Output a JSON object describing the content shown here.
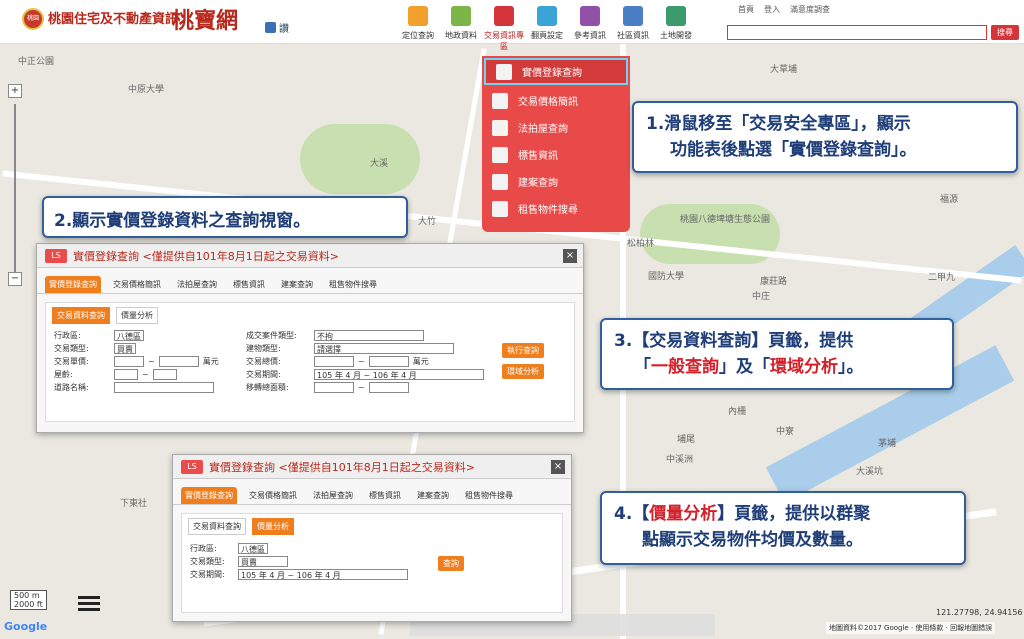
{
  "header": {
    "logo_badge_text": "桃園",
    "logo_text": "桃園住宅及不動產資訊",
    "logo_big": "桃寶網",
    "like_label": "讚",
    "nav": [
      {
        "label": "定位查詢",
        "color": "#f2a02d"
      },
      {
        "label": "地政資料",
        "color": "#7cb648"
      },
      {
        "label": "交易資訊專區",
        "color": "#d3353a"
      },
      {
        "label": "翻頁設定",
        "color": "#3aa4d6"
      },
      {
        "label": "參考資訊",
        "color": "#9251a6"
      },
      {
        "label": "社區資訊",
        "color": "#4b7ec4"
      },
      {
        "label": "土地開發",
        "color": "#3c9b6b"
      }
    ],
    "toplinks": [
      "首頁",
      "登入",
      "滿意度調查"
    ],
    "search_label": "搜尋"
  },
  "dropdown": [
    "實價登錄查詢",
    "交易價格簡訊",
    "法拍屋查詢",
    "標售資訊",
    "建案查詢",
    "租售物件搜尋"
  ],
  "callouts": {
    "c1": [
      "1.滑鼠移至「交易安全專區」，顯示",
      "功能表後點選「實價登錄查詢」。"
    ],
    "c2": "2.顯示實價登錄資料之查詢視窗。",
    "c3a": "3.【交易資料查詢】頁籤，提供",
    "c3b_pre": "「",
    "c3b_red1": "一般查詢",
    "c3b_mid": "」及「",
    "c3b_red2": "環域分析",
    "c3b_post": "」。",
    "c4a_pre": "4.【",
    "c4a_red": "價量分析",
    "c4a_post": "】頁籤，提供以群聚",
    "c4b": "點顯示交易物件均價及數量。"
  },
  "panel1": {
    "icon": "LS",
    "title": "實價登錄查詢 <僅提供自101年8月1日起之交易資料>",
    "close": "×",
    "tabs": [
      "實價登錄查詢",
      "交易價格簡訊",
      "法拍屋查詢",
      "標售資訊",
      "建案查詢",
      "租售物件搜尋"
    ],
    "subtabs": [
      "交易資料查詢",
      "價量分析"
    ],
    "left": [
      {
        "label": "行政區:",
        "value": "八德區"
      },
      {
        "label": "交易類型:",
        "value": "買賣"
      },
      {
        "label": "交易單價:",
        "value": "萬元"
      },
      {
        "label": "屋齡:",
        "value": ""
      },
      {
        "label": "道路名稱:",
        "value": ""
      }
    ],
    "right": [
      {
        "label": "成交案件類型:",
        "value": "不拘"
      },
      {
        "label": "建物類型:",
        "value": "請選擇"
      },
      {
        "label": "交易總價:",
        "value": "萬元"
      },
      {
        "label": "交易期間:",
        "value": "105 年 4 月 ~ 106 年 4 月"
      },
      {
        "label": "移轉總面積:",
        "value": ""
      }
    ],
    "btn_query": "執行查詢",
    "btn_buffer": "環域分析"
  },
  "panel2": {
    "icon": "LS",
    "title": "實價登錄查詢 <僅提供自101年8月1日起之交易資料>",
    "close": "×",
    "tabs": [
      "實價登錄查詢",
      "交易價格簡訊",
      "法拍屋查詢",
      "標售資訊",
      "建案查詢",
      "租售物件搜尋"
    ],
    "subtabs": [
      "交易資料查詢",
      "價量分析"
    ],
    "rows": [
      {
        "label": "行政區:",
        "value": "八德區"
      },
      {
        "label": "交易類型:",
        "value": "買賣"
      },
      {
        "label": "交易期間:",
        "value": "105 年 4 月 ~ 106 年 4 月"
      }
    ],
    "btn_query": "查詢"
  },
  "map_labels": [
    "中正公園",
    "中原大學",
    "大竹",
    "大溪",
    "桃園八德埤塘生態公園",
    "松柏林",
    "國防大學",
    "中庄",
    "二甲九",
    "埔尾",
    "中寮",
    "內柵",
    "茅埔",
    "下東社",
    "中溪洲",
    "福源",
    "大溪坑",
    "大草埔",
    "康莊路"
  ],
  "scale": [
    "500 m",
    "2000 ft"
  ],
  "coords": "121.27798, 24.94156",
  "map_footer": "地圖資料©2017 Google · 使用條款 · 回報地圖錯誤",
  "google": "Google"
}
